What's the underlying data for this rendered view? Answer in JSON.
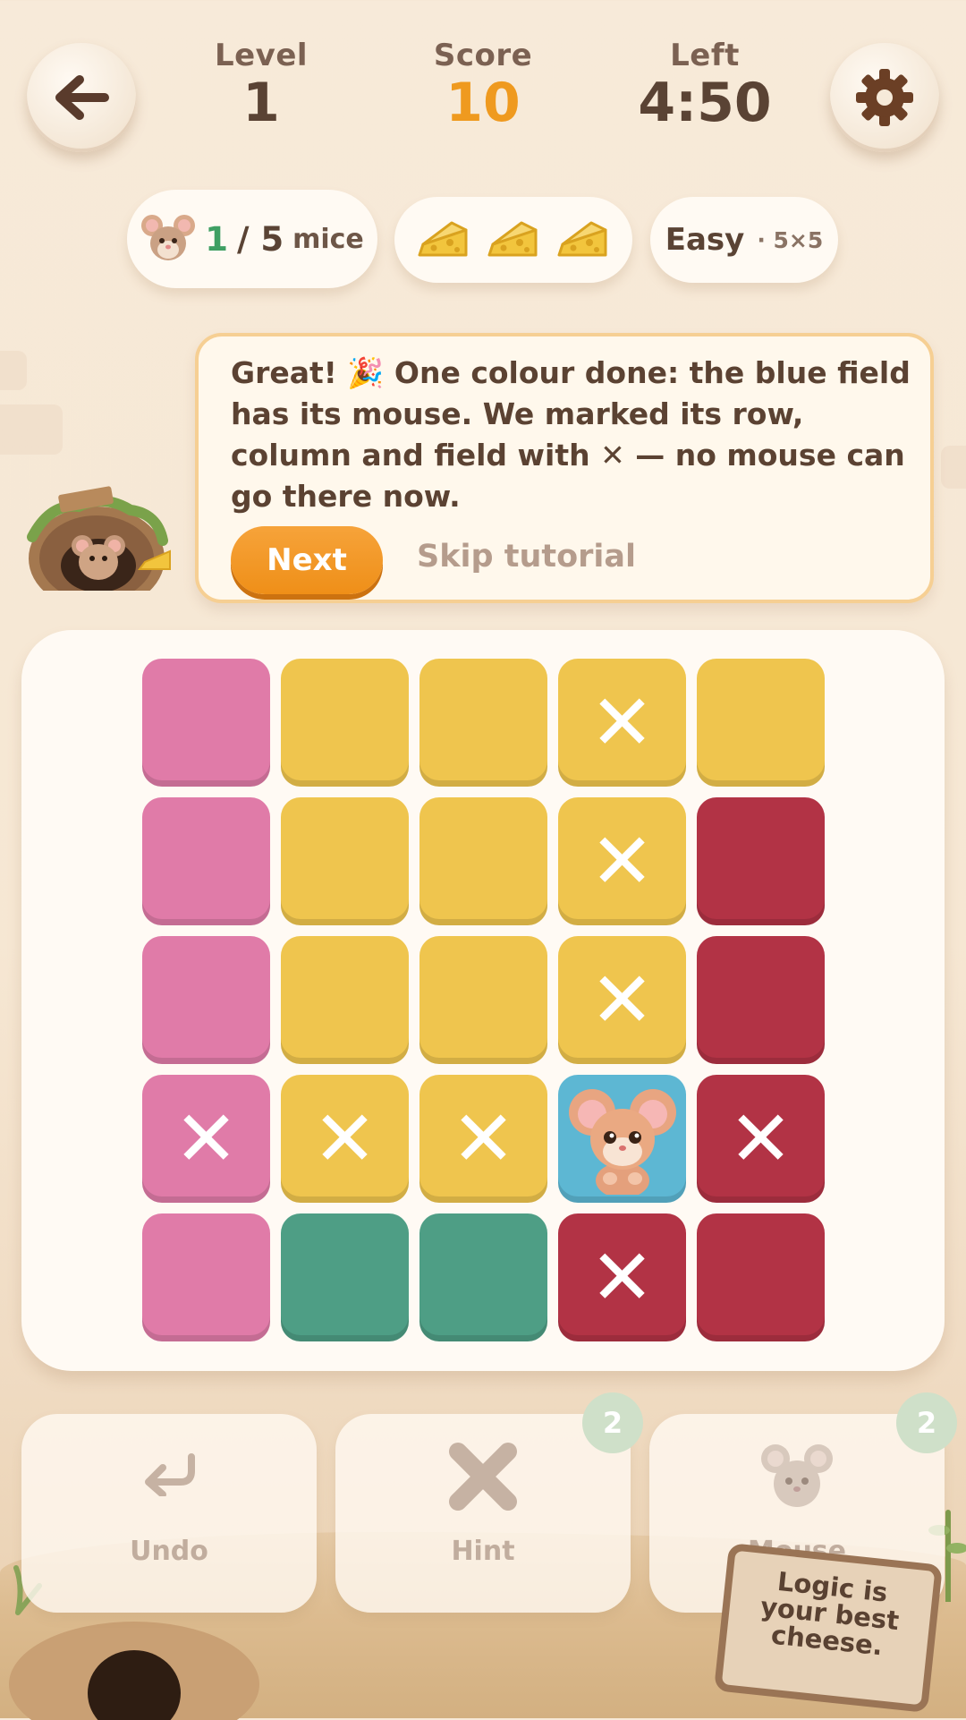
{
  "header": {
    "back_icon": "arrow-left-icon",
    "settings_icon": "gear-icon",
    "level_label": "Level",
    "level_value": "1",
    "score_label": "Score",
    "score_value": "10",
    "left_label": "Left",
    "left_value": "4:50"
  },
  "pills": {
    "mice_found": "1",
    "mice_total_text": "/ 5",
    "mice_unit": "mice",
    "cheese_icons": [
      "cheese-icon",
      "cheese-icon",
      "cheese-icon"
    ],
    "difficulty": "Easy",
    "grid_size": "· 5×5"
  },
  "tutorial": {
    "text": "Great! 🎉 One colour done: the blue field has its mouse. We marked its row, column and field with ✕ — no mouse can go there now.",
    "next_label": "Next",
    "skip_label": "Skip tutorial"
  },
  "board": {
    "size": 5,
    "colors": {
      "pink": "#e07ba8",
      "yellow": "#efc54e",
      "red": "#b23345",
      "blue": "#5db7d3",
      "green": "#4e9e85"
    },
    "cells": [
      [
        {
          "color": "pink",
          "mark": ""
        },
        {
          "color": "yellow",
          "mark": ""
        },
        {
          "color": "yellow",
          "mark": ""
        },
        {
          "color": "yellow",
          "mark": "x"
        },
        {
          "color": "yellow",
          "mark": ""
        }
      ],
      [
        {
          "color": "pink",
          "mark": ""
        },
        {
          "color": "yellow",
          "mark": ""
        },
        {
          "color": "yellow",
          "mark": ""
        },
        {
          "color": "yellow",
          "mark": "x"
        },
        {
          "color": "red",
          "mark": ""
        }
      ],
      [
        {
          "color": "pink",
          "mark": ""
        },
        {
          "color": "yellow",
          "mark": ""
        },
        {
          "color": "yellow",
          "mark": ""
        },
        {
          "color": "yellow",
          "mark": "x"
        },
        {
          "color": "red",
          "mark": ""
        }
      ],
      [
        {
          "color": "pink",
          "mark": "x"
        },
        {
          "color": "yellow",
          "mark": "x"
        },
        {
          "color": "yellow",
          "mark": "x"
        },
        {
          "color": "blue",
          "mark": "mouse"
        },
        {
          "color": "red",
          "mark": "x"
        }
      ],
      [
        {
          "color": "pink",
          "mark": ""
        },
        {
          "color": "green",
          "mark": ""
        },
        {
          "color": "green",
          "mark": ""
        },
        {
          "color": "red",
          "mark": "x"
        },
        {
          "color": "red",
          "mark": ""
        }
      ]
    ],
    "x_glyph": "✕"
  },
  "tools": {
    "undo_label": "Undo",
    "undo_icon": "undo-arrow-icon",
    "hint_label": "Hint",
    "hint_icon": "x-mark-icon",
    "hint_count": "2",
    "mouse_label": "Mouse",
    "mouse_icon": "mouse-icon",
    "mouse_count": "2"
  },
  "decor": {
    "sign_line1": "Logic is",
    "sign_line2": "your best",
    "sign_line3": "cheese."
  }
}
